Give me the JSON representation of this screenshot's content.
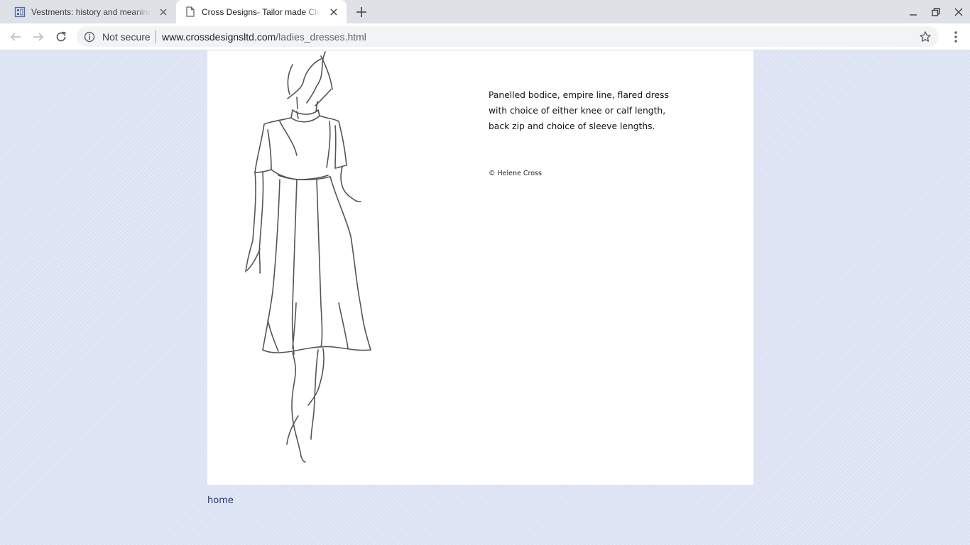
{
  "browser": {
    "tabs": [
      {
        "title": "Vestments: history and meaning",
        "favicon": "page-grid-icon",
        "active": false
      },
      {
        "title": "Cross Designs- Tailor made Clergy",
        "favicon": "document-icon",
        "active": true
      }
    ],
    "address": {
      "security_label": "Not secure",
      "url_host": "www.crossdesignsltd.com",
      "url_path": "/ladies_dresses.html"
    }
  },
  "page": {
    "description_lines": [
      "Panelled bodice, empire line, flared dress",
      "with choice of either knee or calf length,",
      "back zip and choice of sleeve lengths."
    ],
    "copyright": "© Helene Cross",
    "home_link": "home",
    "image": "dress-sketch-drawing"
  },
  "colors": {
    "page_background": "#dbe2f3",
    "panel": "#ffffff",
    "link": "#1f3a7a",
    "tabstrip": "#dee1e6"
  }
}
